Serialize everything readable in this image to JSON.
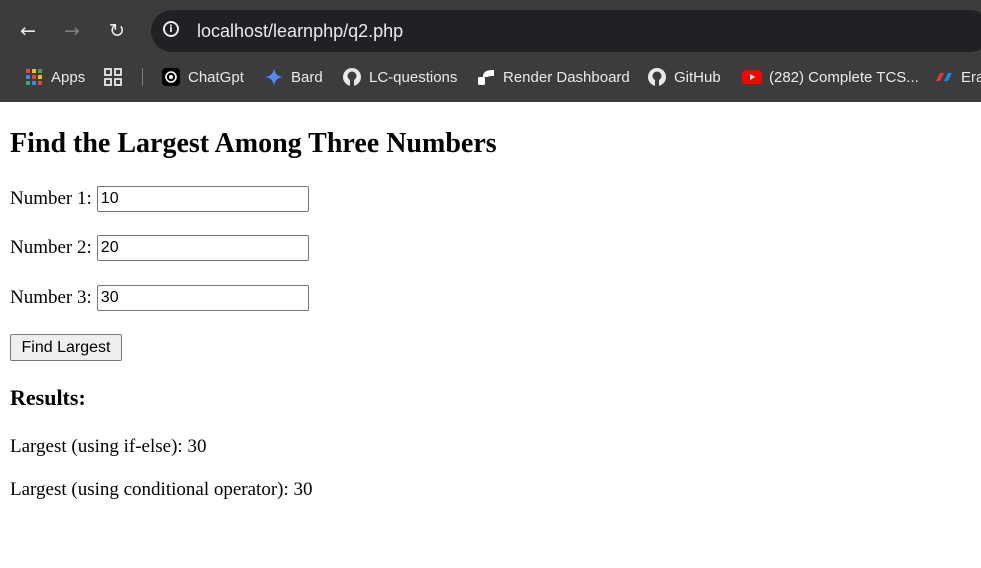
{
  "browser": {
    "url": "localhost/learnphp/q2.php",
    "bookmarks": [
      {
        "label": "Apps",
        "icon": "apps-grid-icon"
      },
      {
        "label": "",
        "icon": "tab-groups-icon"
      },
      {
        "label": "ChatGpt",
        "icon": "chatgpt-icon"
      },
      {
        "label": "Bard",
        "icon": "bard-sparkle-icon"
      },
      {
        "label": "LC-questions",
        "icon": "github-icon"
      },
      {
        "label": "Render Dashboard",
        "icon": "render-icon"
      },
      {
        "label": "GitHub",
        "icon": "github-icon"
      },
      {
        "label": "(282) Complete TCS...",
        "icon": "youtube-icon"
      },
      {
        "label": "Era",
        "icon": "era-icon"
      }
    ]
  },
  "page": {
    "title": "Find the Largest Among Three Numbers",
    "fields": [
      {
        "label": "Number 1:",
        "value": "10"
      },
      {
        "label": "Number 2:",
        "value": "20"
      },
      {
        "label": "Number 3:",
        "value": "30"
      }
    ],
    "submit_label": "Find Largest",
    "results_heading": "Results:",
    "results": [
      "Largest (using if-else): 30",
      "Largest (using conditional operator): 30"
    ]
  },
  "colors": {
    "chrome_bg": "#3c3c3c",
    "omnibox_bg": "#202124",
    "chrome_text": "#e8eaed",
    "youtube_red": "#ff0000",
    "bard_blue": "#4e8cf7"
  }
}
